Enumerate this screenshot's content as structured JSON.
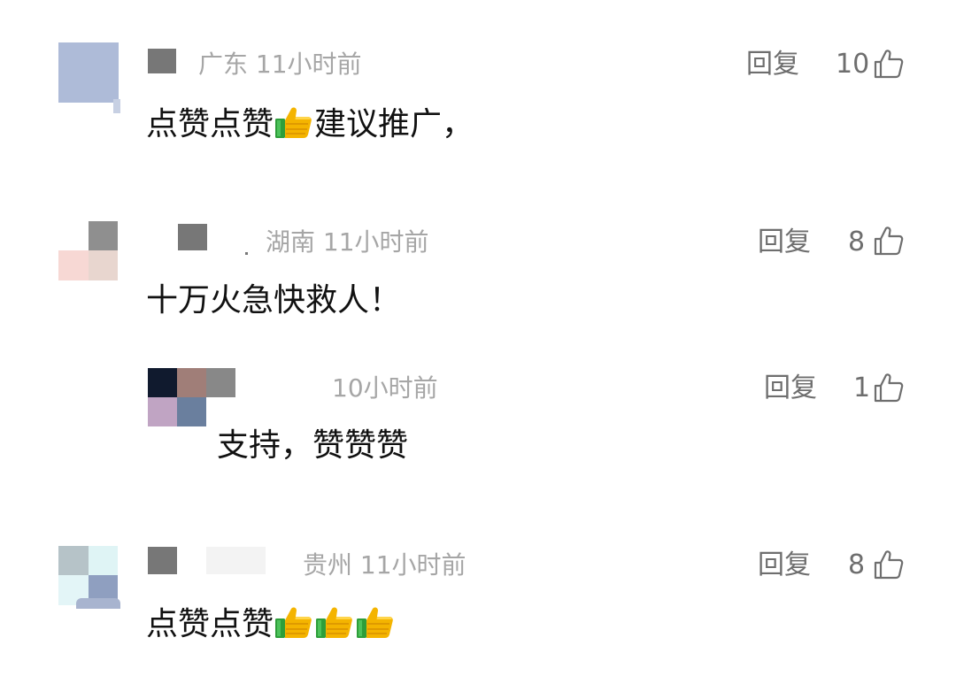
{
  "comments": [
    {
      "location": "广东",
      "time": "11小时前",
      "reply_label": "回复",
      "likes": "10",
      "text_before": "点赞点赞",
      "text_after": "建议推广，",
      "thumb_emoji_count": 1
    },
    {
      "location": "湖南",
      "time": "11小时前",
      "reply_label": "回复",
      "likes": "8",
      "text": "十万火急快救人！",
      "reply": {
        "time": "10小时前",
        "reply_label": "回复",
        "likes": "1",
        "text": "支持，赞赞赞"
      }
    },
    {
      "location": "贵州",
      "time": "11小时前",
      "reply_label": "回复",
      "likes": "8",
      "text_before": "点赞点赞",
      "thumb_emoji_count": 3
    }
  ],
  "icons": {
    "like": "thumbs-up-outline-icon",
    "emoji": "thumbs-up-emoji-icon"
  },
  "colors": {
    "meta_text": "#a6a6a6",
    "action_text": "#6e6e6e",
    "body_text": "#111111",
    "emoji_thumb": "#f4b400",
    "emoji_cuff": "#2e9e3a"
  }
}
